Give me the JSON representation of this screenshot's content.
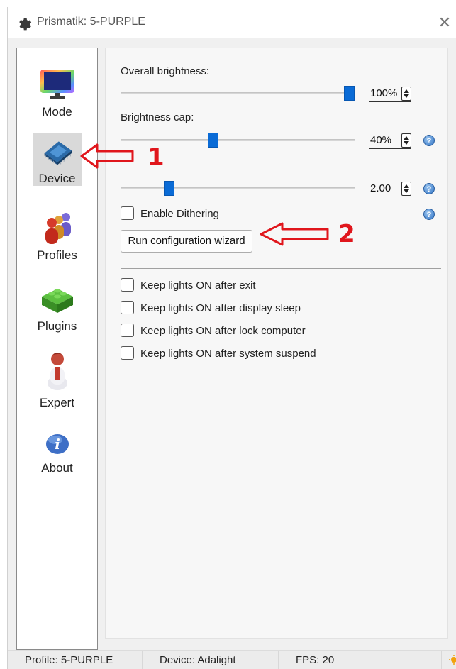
{
  "window": {
    "title": "Prismatik: 5-PURPLE",
    "close_glyph": "✕"
  },
  "sidebar": {
    "items": [
      {
        "label": "Mode",
        "icon": "monitor-rainbow-icon"
      },
      {
        "label": "Device",
        "icon": "chip-icon",
        "selected": true
      },
      {
        "label": "Profiles",
        "icon": "people-icon"
      },
      {
        "label": "Plugins",
        "icon": "lego-brick-icon"
      },
      {
        "label": "Expert",
        "icon": "expert-figure-icon"
      },
      {
        "label": "About",
        "icon": "info-icon"
      }
    ]
  },
  "device": {
    "overall_brightness_label": "Overall brightness:",
    "overall_brightness_value": "100%",
    "overall_brightness_level": 1.0,
    "brightness_cap_label": "Brightness cap:",
    "brightness_cap_value": "40%",
    "brightness_cap_level": 0.4,
    "gamma_value": "2.00",
    "gamma_level": 0.2,
    "enable_dithering_label": "Enable Dithering",
    "enable_dithering_checked": false,
    "run_wizard_label": "Run configuration wizard",
    "help_glyph": "?",
    "keep_lights": [
      {
        "label": "Keep lights ON after exit",
        "checked": false
      },
      {
        "label": "Keep lights ON after display sleep",
        "checked": false
      },
      {
        "label": "Keep lights ON after lock computer",
        "checked": false
      },
      {
        "label": "Keep lights ON after system suspend",
        "checked": false
      }
    ]
  },
  "annotations": {
    "one": "1",
    "two": "2",
    "color": "#e0161c"
  },
  "statusbar": {
    "profile": "Profile: 5-PURPLE",
    "device": "Device: Adalight",
    "fps": "FPS: 20"
  },
  "colors": {
    "accent": "#0a6bd6",
    "arrow_red": "#e0161c"
  }
}
